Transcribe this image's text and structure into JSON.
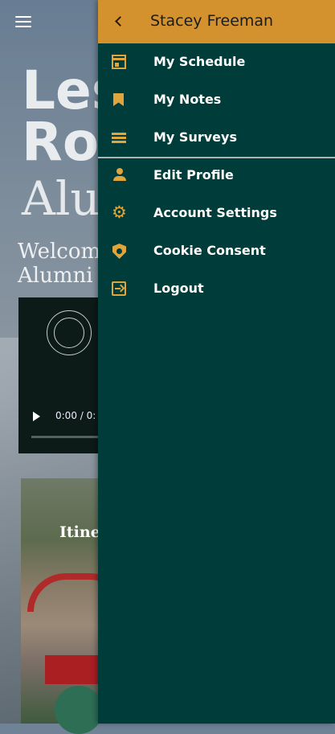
{
  "background": {
    "hero_line1": "Les",
    "hero_line2": "Ro",
    "hero_line3": "Alu",
    "welcome": "Welcom\nAlumni",
    "video": {
      "time": "0:00 / 0:"
    },
    "card": {
      "title": "Itiner"
    }
  },
  "drawer": {
    "title": "Stacey Freeman",
    "accent_color": "#d4922f",
    "background_color": "#003d3a",
    "items": [
      {
        "label": "My Schedule",
        "icon": "calendar-icon"
      },
      {
        "label": "My Notes",
        "icon": "bookmark-icon"
      },
      {
        "label": "My Surveys",
        "icon": "list-icon"
      },
      {
        "label": "Edit Profile",
        "icon": "person-icon"
      },
      {
        "label": "Account Settings",
        "icon": "gear-icon"
      },
      {
        "label": "Cookie Consent",
        "icon": "shield-icon"
      },
      {
        "label": "Logout",
        "icon": "logout-icon"
      }
    ]
  }
}
